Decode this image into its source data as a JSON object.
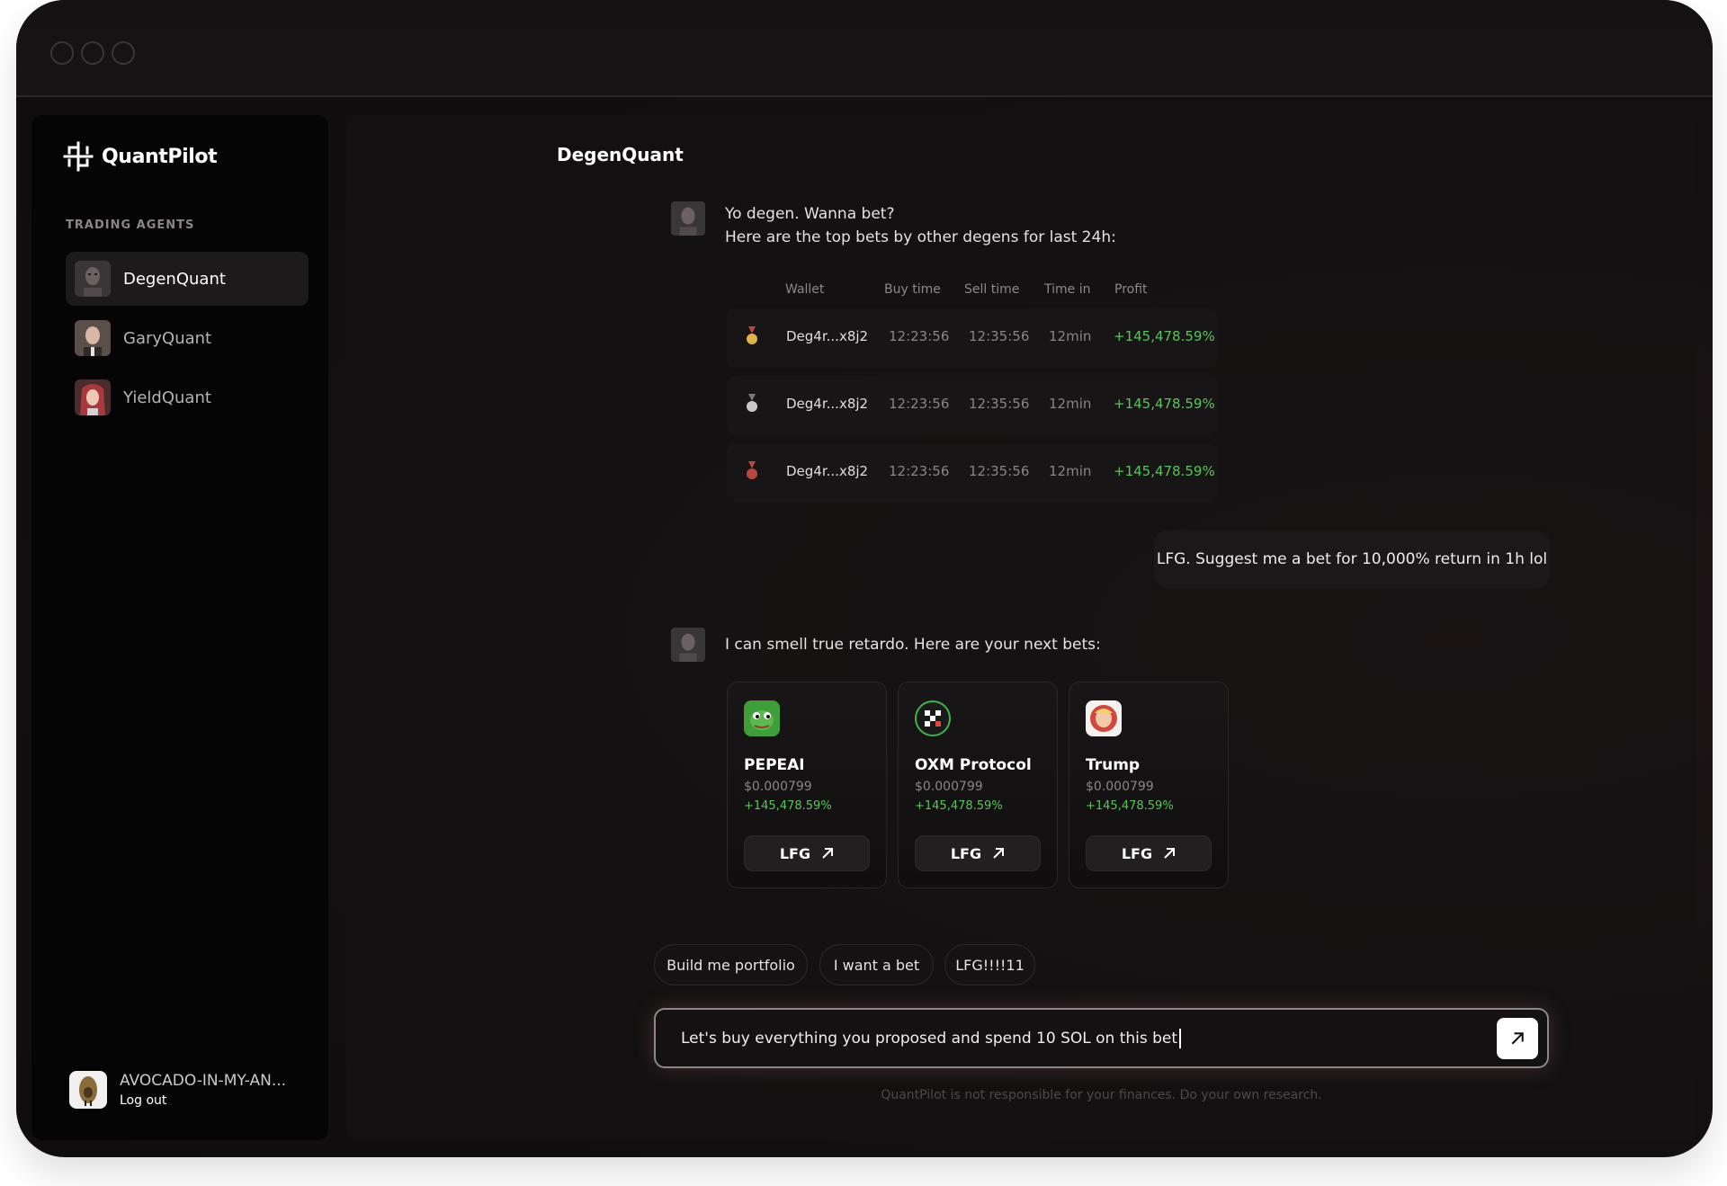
{
  "brand": {
    "name": "QuantPilot"
  },
  "sidebar": {
    "section_label": "TRADING AGENTS",
    "agents": [
      {
        "name": "DegenQuant",
        "active": true
      },
      {
        "name": "GaryQuant",
        "active": false
      },
      {
        "name": "YieldQuant",
        "active": false
      }
    ],
    "user": {
      "name": "AVOCADO-IN-MY-AN...",
      "logout": "Log out"
    }
  },
  "chat": {
    "title": "DegenQuant",
    "message1": {
      "line1": "Yo degen. Wanna bet?",
      "line2": "Here are the top bets by other degens for last 24h:"
    },
    "table": {
      "headers": [
        "Wallet",
        "Buy time",
        "Sell time",
        "Time in",
        "Profit"
      ],
      "rows": [
        {
          "medal": "gold",
          "wallet": "Deg4r...x8j2",
          "buy": "12:23:56",
          "sell": "12:35:56",
          "time_in": "12min",
          "profit": "+145,478.59%"
        },
        {
          "medal": "silver",
          "wallet": "Deg4r...x8j2",
          "buy": "12:23:56",
          "sell": "12:35:56",
          "time_in": "12min",
          "profit": "+145,478.59%"
        },
        {
          "medal": "bronze",
          "wallet": "Deg4r...x8j2",
          "buy": "12:23:56",
          "sell": "12:35:56",
          "time_in": "12min",
          "profit": "+145,478.59%"
        }
      ]
    },
    "user_message": "LFG. Suggest me a bet for 10,000% return in 1h lol",
    "message2": "I can smell true retardo. Here are your next bets:",
    "bets": [
      {
        "name": "PEPEAI",
        "price": "$0.000799",
        "change": "+145,478.59%",
        "cta": "LFG"
      },
      {
        "name": "OXM Protocol",
        "price": "$0.000799",
        "change": "+145,478.59%",
        "cta": "LFG"
      },
      {
        "name": "Trump",
        "price": "$0.000799",
        "change": "+145,478.59%",
        "cta": "LFG"
      }
    ],
    "suggestions": [
      "Build me portfolio",
      "I want a bet",
      "LFG!!!!11"
    ],
    "input_value": "Let's buy everything you proposed and spend 10 SOL on this bet",
    "disclaimer": "QuantPilot is not responsible for your finances. Do your own research."
  },
  "colors": {
    "accent_green": "#5cc35c",
    "background": "#0e0c0d",
    "sidebar": "#050505"
  }
}
